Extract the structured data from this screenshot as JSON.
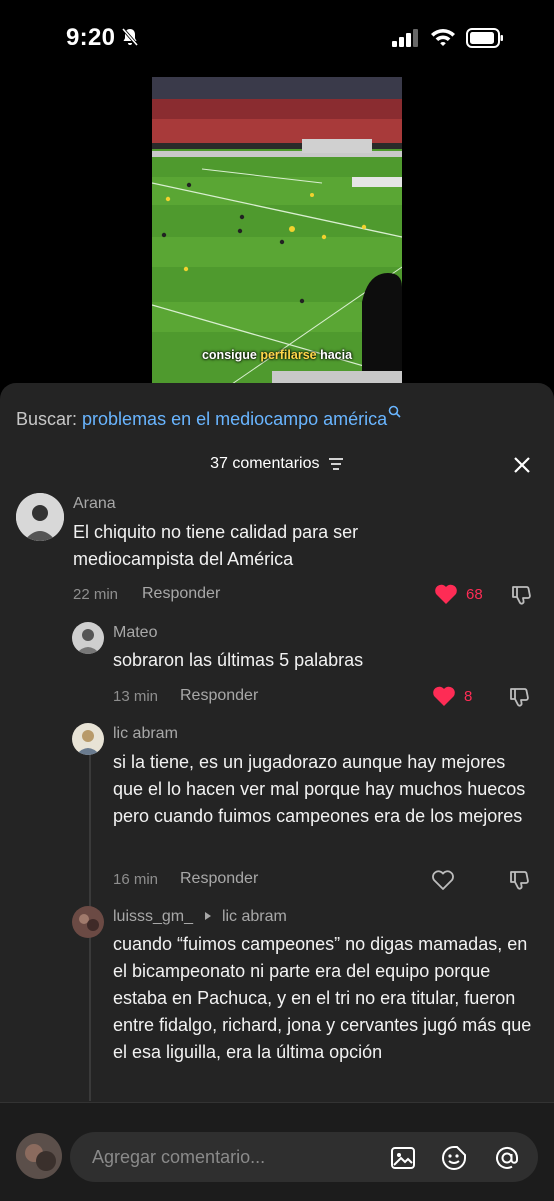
{
  "status_bar": {
    "time": "9:20"
  },
  "video": {
    "caption_prefix": "consigue ",
    "caption_highlight": "perfilarse",
    "caption_suffix": " hacia"
  },
  "search": {
    "label": "Buscar: ",
    "query": "problemas en el mediocampo américa"
  },
  "comments_header": {
    "count_label": "37 comentarios"
  },
  "comments": [
    {
      "user": "Arana",
      "text": "El chiquito no tiene calidad para ser mediocampista del América",
      "time": "22 min",
      "reply_label": "Responder",
      "likes": "68",
      "liked": true
    },
    {
      "user": "Mateo",
      "text": "sobraron las últimas 5 palabras",
      "time": "13 min",
      "reply_label": "Responder",
      "likes": "8",
      "liked": true
    },
    {
      "user": "lic abram",
      "text": "si la tiene, es un jugadorazo aunque hay mejores que el lo hacen ver mal porque hay muchos huecos pero cuando fuimos campeones era de los mejores",
      "time": "16 min",
      "reply_label": "Responder",
      "likes": "",
      "liked": false
    },
    {
      "user": "luisss_gm_",
      "reply_to": "lic abram",
      "text": "cuando “fuimos campeones” no digas mamadas, en el bicampeonato ni parte era del equipo porque estaba en Pachuca, y en el tri no era titular, fueron entre fidalgo, richard, jona y cervantes jugó más que el esa liguilla, era la última opción"
    }
  ],
  "composer": {
    "placeholder": "Agregar comentario..."
  },
  "colors": {
    "accent_like": "#fe2c55",
    "search_link": "#69b5ff",
    "sheet_bg": "#242424"
  }
}
